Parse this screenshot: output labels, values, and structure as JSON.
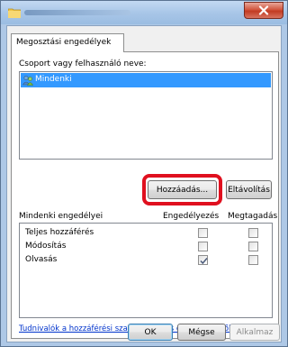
{
  "tab": {
    "label": "Megosztási engedélyek"
  },
  "group_label": "Csoport vagy felhasználó neve:",
  "users": [
    {
      "name": "Mindenki"
    }
  ],
  "buttons": {
    "add": "Hozzáadás...",
    "remove": "Eltávolítás"
  },
  "permissions": {
    "heading": "Mindenki engedélyei",
    "allow_header": "Engedélyezés",
    "deny_header": "Megtagadás",
    "rows": [
      {
        "name": "Teljes hozzáférés",
        "allow": false,
        "deny": false
      },
      {
        "name": "Módosítás",
        "allow": false,
        "deny": false
      },
      {
        "name": "Olvasás",
        "allow": true,
        "deny": false
      }
    ]
  },
  "help_link": "Tudnivalók a hozzáférési szabályokról és engedélyekről",
  "footer": {
    "ok": "OK",
    "cancel": "Mégse",
    "apply": "Alkalmaz"
  },
  "icons": {
    "title": "folder-icon",
    "close": "close-icon",
    "user": "users-group-icon",
    "check": "checkmark-icon"
  },
  "colors": {
    "highlight": "#e0101f",
    "selection": "#3399ff",
    "link": "#0033cc"
  }
}
